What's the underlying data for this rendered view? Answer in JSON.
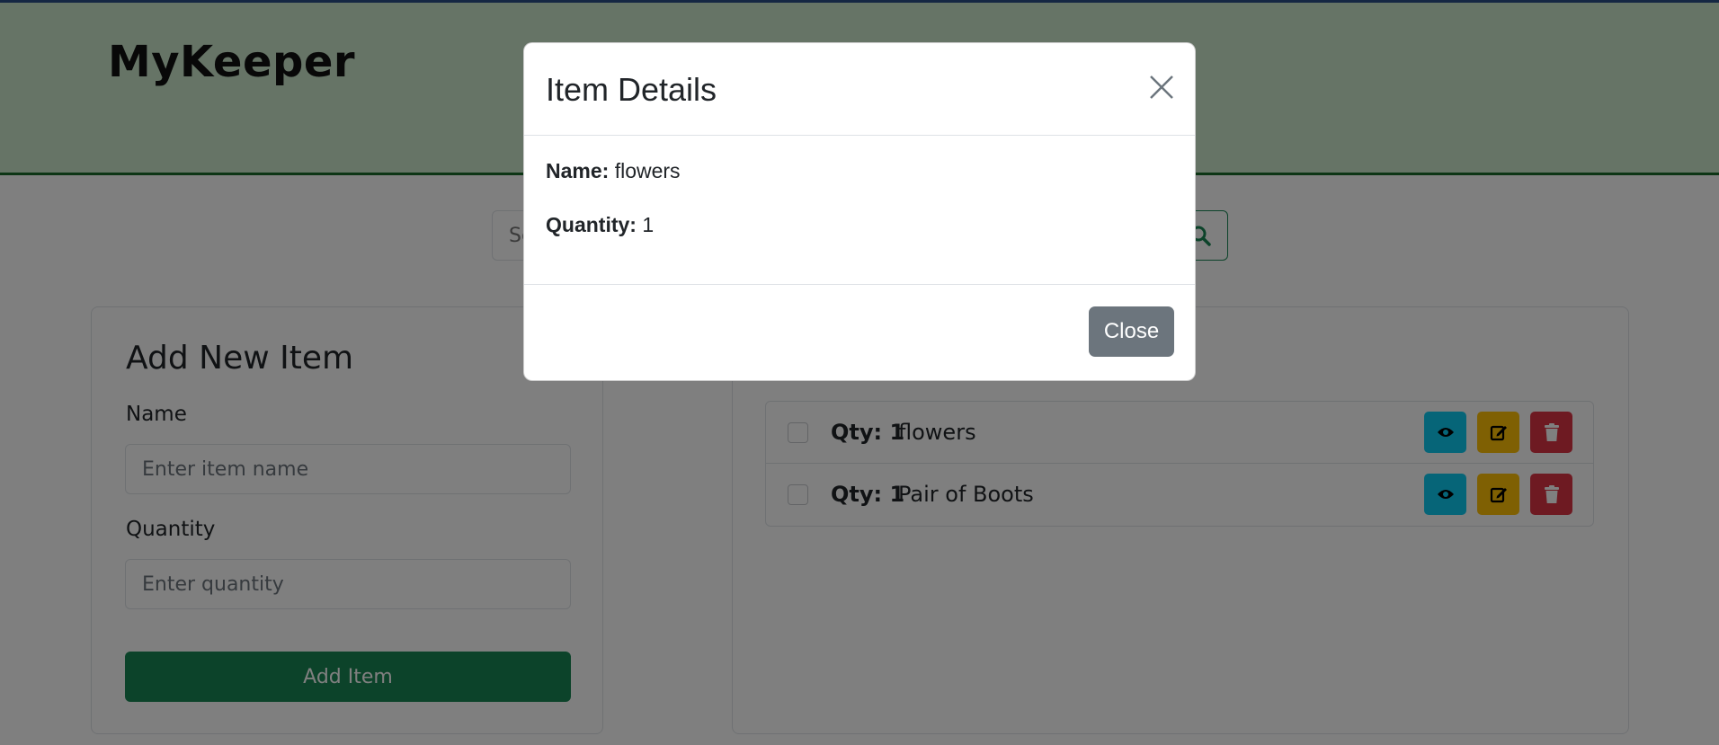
{
  "app": {
    "brand": "MyKeeper"
  },
  "search": {
    "placeholder": "Search items...",
    "button_icon": "search-icon"
  },
  "add_form": {
    "title": "Add New Item",
    "name_label": "Name",
    "name_placeholder": "Enter item name",
    "quantity_label": "Quantity",
    "quantity_placeholder": "Enter quantity",
    "submit_label": "Add Item"
  },
  "items": [
    {
      "qty_label": "Qty: 1",
      "name": "flowers",
      "actions": [
        "eye-icon",
        "edit-icon",
        "trash-icon"
      ]
    },
    {
      "qty_label": "Qty: 1",
      "name": "Pair of Boots",
      "actions": [
        "eye-icon",
        "edit-icon",
        "trash-icon"
      ]
    }
  ],
  "modal": {
    "title": "Item Details",
    "name_label": "Name:",
    "name_value": "flowers",
    "quantity_label": "Quantity:",
    "quantity_value": "1",
    "close_label": "Close"
  },
  "colors": {
    "header_bg": "#cce8cd",
    "header_border": "#1a6b2b",
    "primary_green": "#198754",
    "view_button": "#0dcaf0",
    "edit_button": "#ffc107",
    "delete_button": "#dc3545",
    "close_button": "#6c757d"
  }
}
